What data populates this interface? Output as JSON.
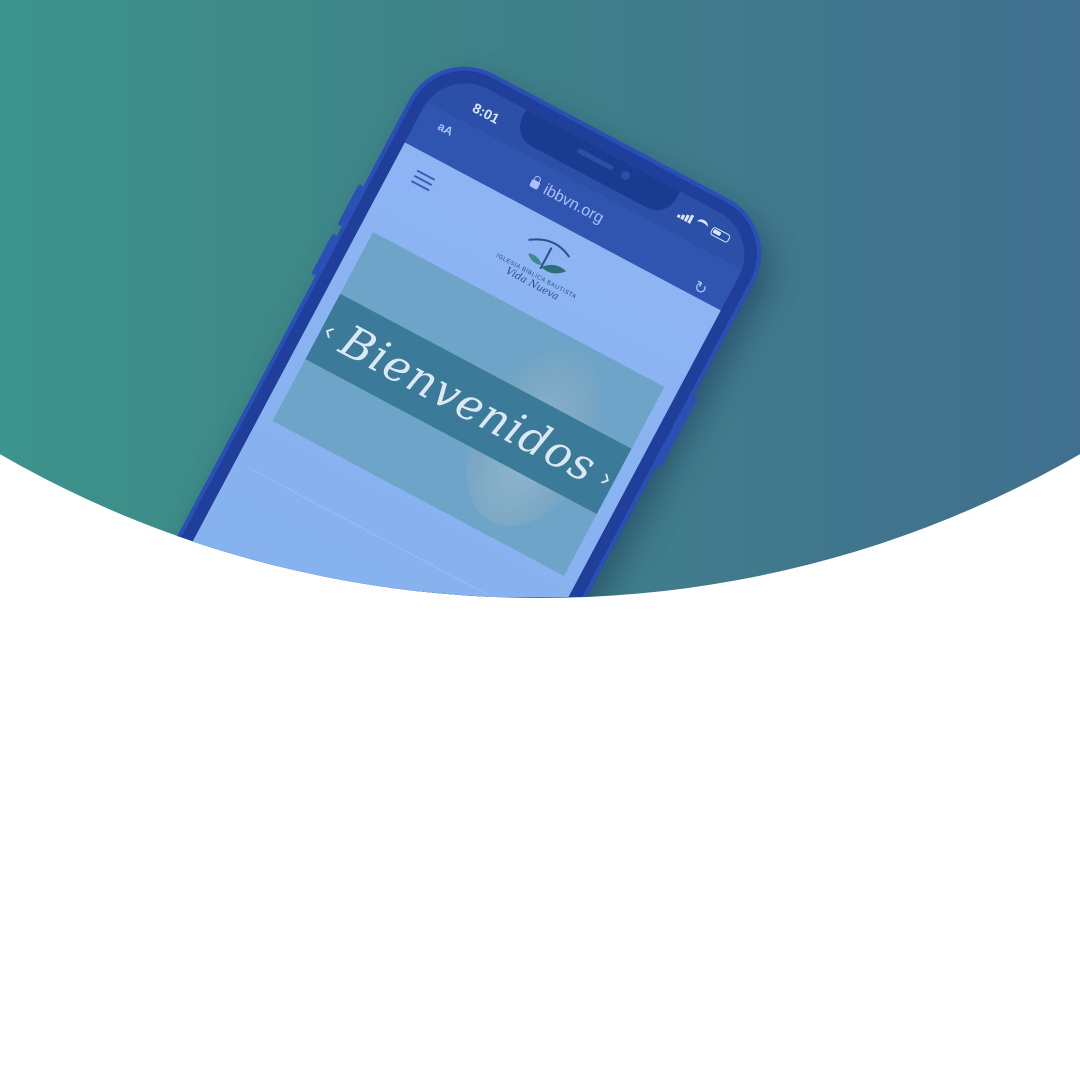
{
  "phone": {
    "time": "8:01",
    "browser": {
      "text_size_label": "aA",
      "url": "ibbvn.org"
    },
    "site": {
      "logo_line1": "IGLESIA BÍBLICA BAUTISTA",
      "logo_line2": "Vida Nueva",
      "hero_banner": "Bienvenidos",
      "prev_arrow": "‹",
      "next_arrow": "›"
    }
  },
  "colors": {
    "gradient_start": "#37a896",
    "gradient_end": "#3f6293",
    "phone_body": "#1f3f9a",
    "screen_tint": "#8eb4f4"
  },
  "icons": [
    "menu-icon",
    "lock-icon",
    "reload-icon",
    "signal-icon",
    "wifi-icon",
    "battery-icon"
  ]
}
